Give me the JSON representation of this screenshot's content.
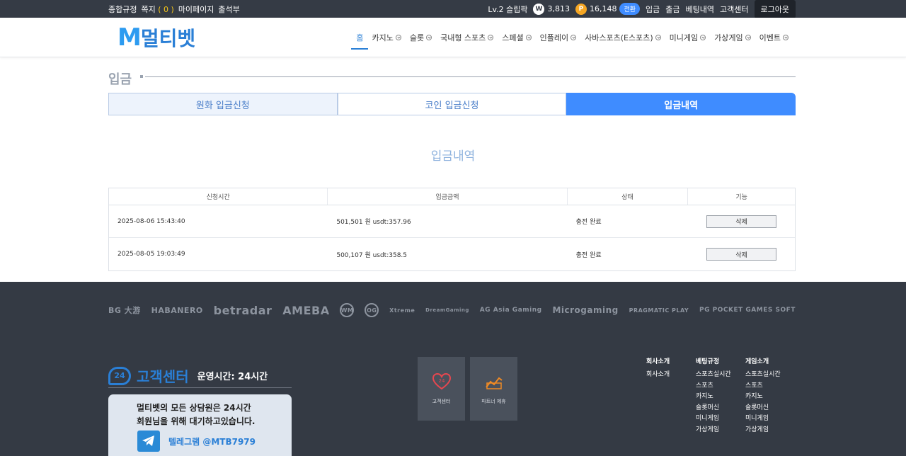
{
  "topbar": {
    "rules": "종합규정",
    "messages_label": "쪽지",
    "messages_count": "( 0 )",
    "mypage": "마이페이지",
    "attendance": "출석부",
    "level_user": "Lv.2 슬립팍",
    "w_icon": "W",
    "w_points": "3,813",
    "p_icon": "P",
    "p_points": "16,148",
    "convert": "전환",
    "deposit": "입금",
    "withdraw": "출금",
    "betting": "베팅내역",
    "support": "고객센터",
    "logout": "로그아웃"
  },
  "header": {
    "logo_mark": "M",
    "logo_text": "멀티벳",
    "nav": [
      "홈",
      "카지노",
      "슬롯",
      "국내형 스포츠",
      "스페셜",
      "인플레이",
      "사바스포츠(E스포츠)",
      "미니게임",
      "가상게임",
      "이벤트"
    ]
  },
  "page": {
    "title": "입금",
    "tabs": [
      "원화 입금신청",
      "코인 입금신청",
      "입금내역"
    ],
    "section_title": "입금내역"
  },
  "table": {
    "headers": [
      "신청시간",
      "입금금액",
      "상태",
      "기능"
    ],
    "rows": [
      {
        "time": "2025-08-06 15:43:40",
        "amount": "501,501 원 usdt:357.96",
        "status": "충전 완료",
        "action": "삭제"
      },
      {
        "time": "2025-08-05 19:03:49",
        "amount": "500,107 원 usdt:358.5",
        "status": "충전 완료",
        "action": "삭제"
      }
    ]
  },
  "footer": {
    "providers": [
      "BG 大游",
      "HABANERO",
      "betradar",
      "AMEBA",
      "WM",
      "OG",
      "Xtreme",
      "DreamGaming",
      "AG Asia Gaming",
      "Microgaming",
      "PRAGMATIC PLAY",
      "PG POCKET GAMES SOFT"
    ],
    "cs_badge": "24",
    "cs_title": "고객센터",
    "cs_hours": "운영시간: 24시간",
    "cs_line1": "멀티벳의 모든 상담원은 24시간",
    "cs_line2": "회원님을 위해 대기하고있습니다.",
    "telegram": "텔레그램 @MTB7979",
    "btn_support": "고객센터",
    "btn_partner": "파트너 제휴",
    "col1_title": "회사소개",
    "col1_items": [
      "회사소개"
    ],
    "col2_title": "베팅규정",
    "col2_items": [
      "스포츠실시간",
      "스포츠",
      "카지노",
      "슬롯머신",
      "미니게임",
      "가상게임"
    ],
    "col3_title": "게임소개",
    "col3_items": [
      "스포츠실시간",
      "스포츠",
      "카지노",
      "슬롯머신",
      "미니게임",
      "가상게임"
    ]
  },
  "colors": {
    "accent": "#3f8cff",
    "topbar_bg": "#353b45",
    "footer_bg": "#343a44",
    "title_gray": "#9aa3b0"
  }
}
